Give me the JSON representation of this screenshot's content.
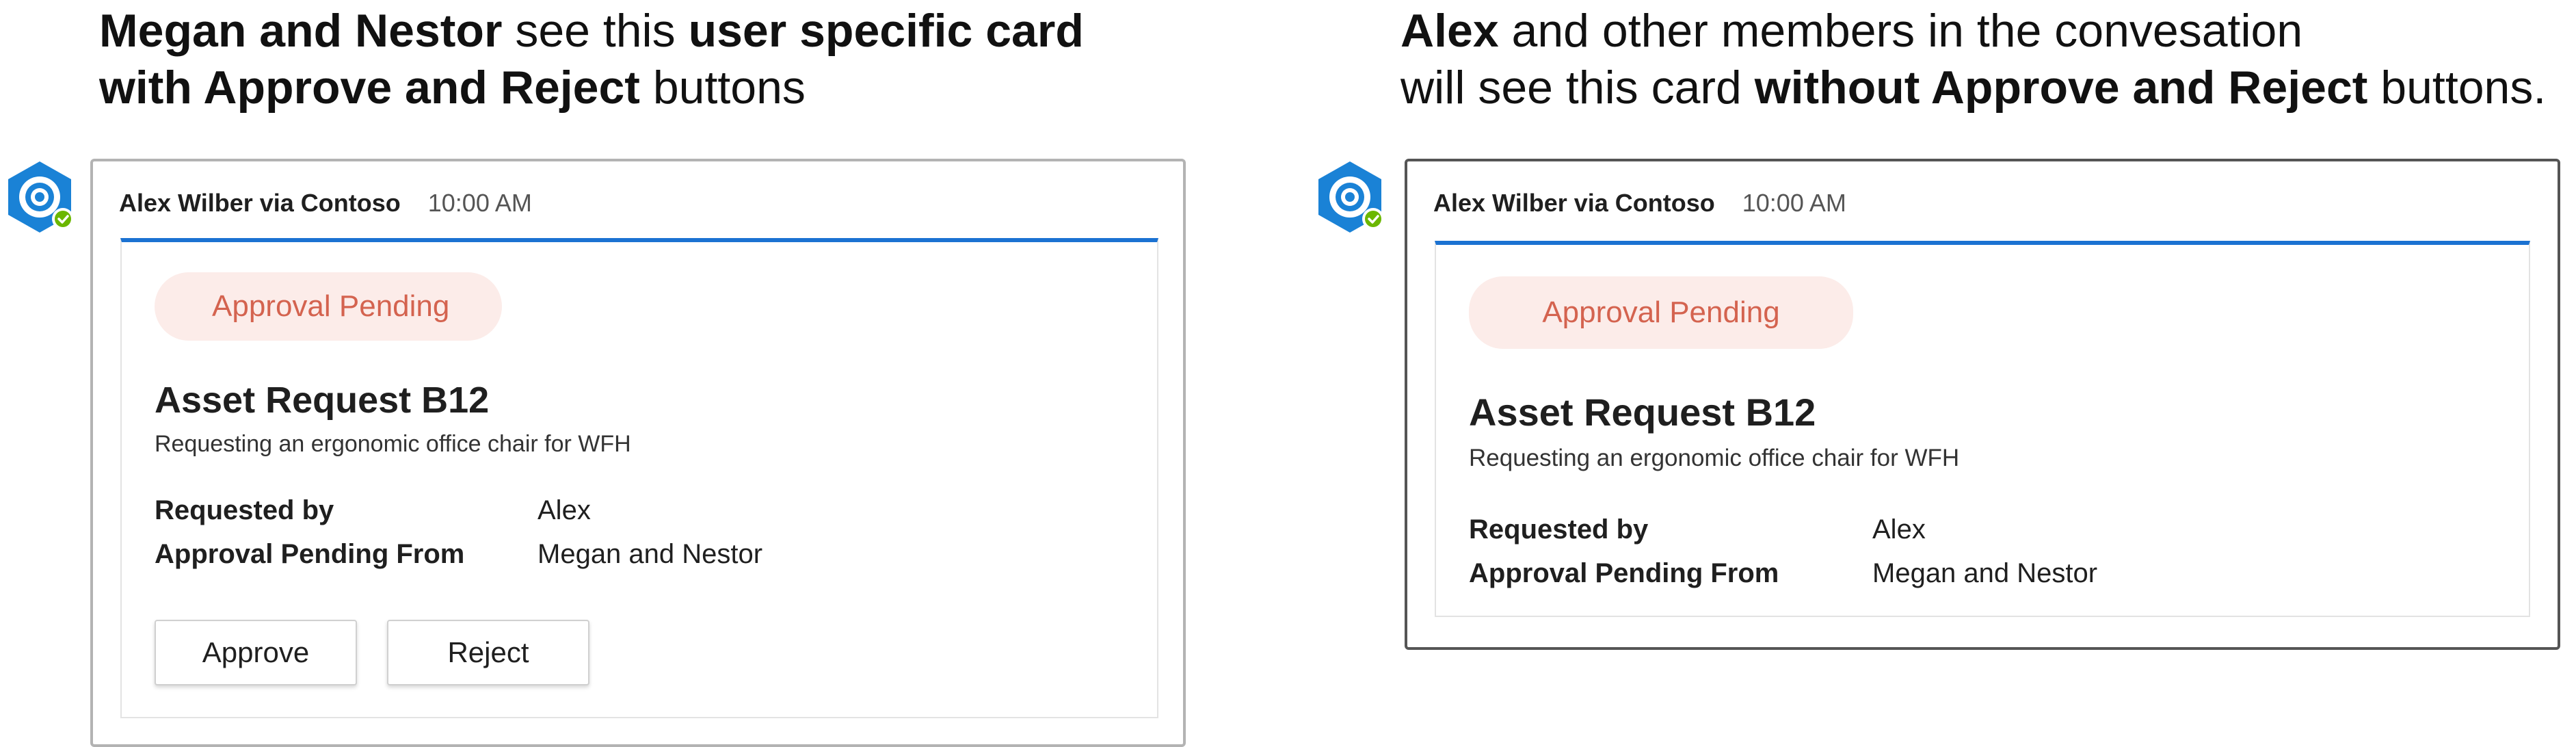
{
  "captions": {
    "left": {
      "line1_bold1": "Megan and Nestor",
      "line1_text": " see this ",
      "line1_bold2": "user specific card",
      "line2_bold": "with Approve and Reject",
      "line2_text": " buttons"
    },
    "right": {
      "line1_bold": "Alex",
      "line1_text": " and other members in the convesation",
      "line2_text1": "will see this card ",
      "line2_bold": "without Approve and Reject",
      "line2_text2": " buttons."
    }
  },
  "cards": {
    "left": {
      "sender": "Alex Wilber via Contoso",
      "time": "10:00 AM",
      "status_pill": "Approval Pending",
      "title": "Asset Request B12",
      "subtitle": "Requesting an ergonomic office chair for WFH",
      "facts": [
        {
          "key": "Requested by",
          "value": "Alex"
        },
        {
          "key": "Approval Pending From",
          "value": "Megan and Nestor"
        }
      ],
      "actions": {
        "approve": "Approve",
        "reject": "Reject"
      }
    },
    "right": {
      "sender": "Alex Wilber via Contoso",
      "time": "10:00 AM",
      "status_pill": "Approval Pending",
      "title": "Asset Request B12",
      "subtitle": "Requesting an ergonomic office chair for WFH",
      "facts": [
        {
          "key": "Requested by",
          "value": "Alex"
        },
        {
          "key": "Approval Pending From",
          "value": "Megan and Nestor"
        }
      ]
    }
  },
  "icons": {
    "bot_avatar": "bot-avatar-icon",
    "presence": "available-presence-icon"
  },
  "colors": {
    "accent_bar": "#1b72d2",
    "pill_bg": "#fcece9",
    "pill_text": "#d4634f",
    "avatar_blue": "#1a82d6",
    "presence_green": "#6bb700"
  }
}
